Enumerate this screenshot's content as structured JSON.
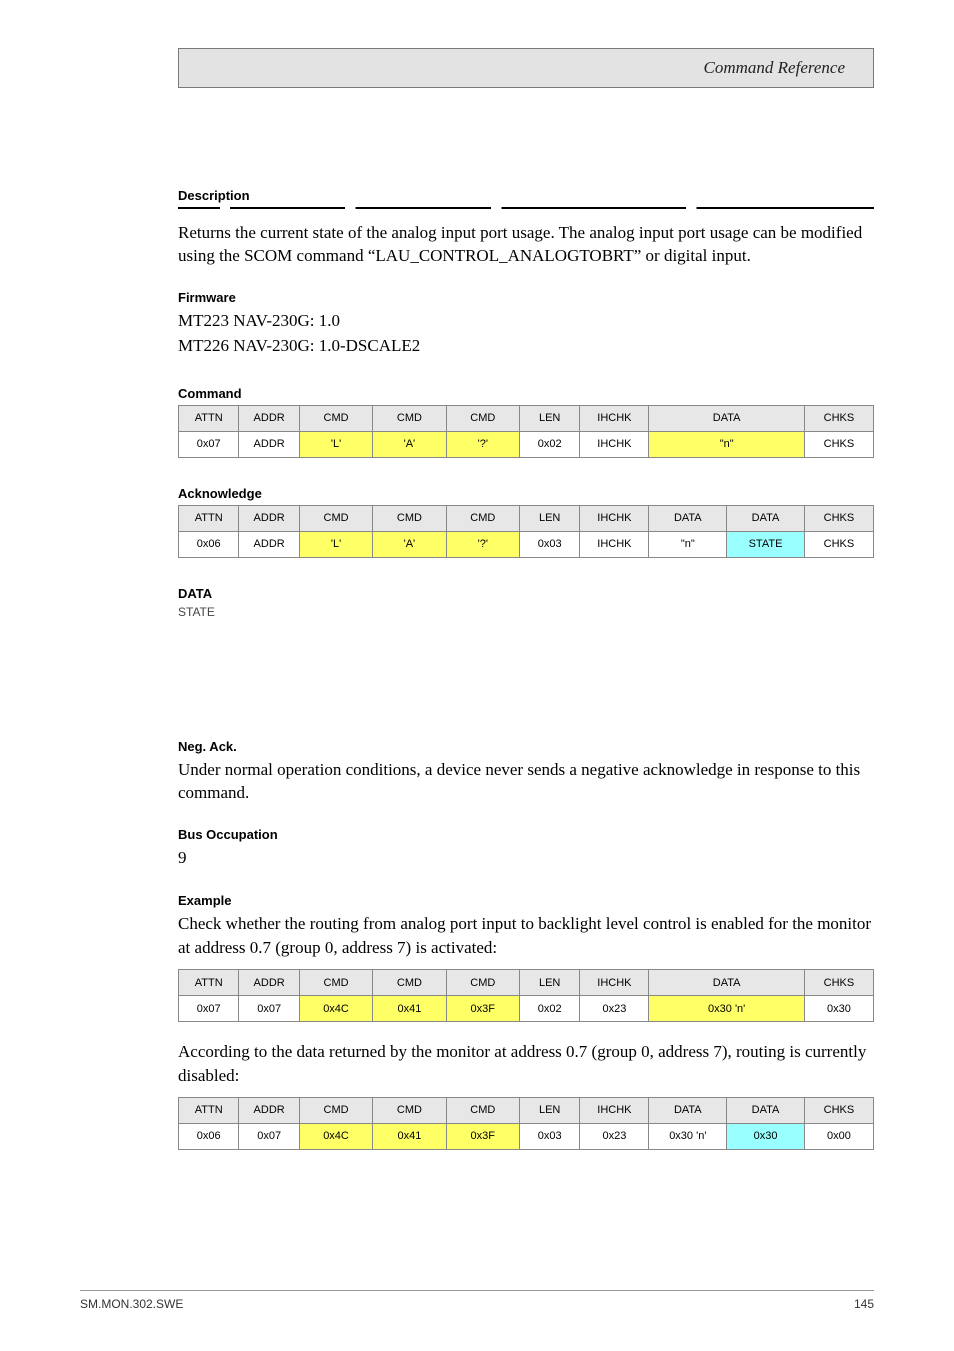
{
  "header": {
    "title": "Command Reference"
  },
  "description": {
    "label": "Description",
    "text": "Returns the current state of the analog input port usage. The analog input port usage can be modified using the SCOM command “LAU_CONTROL_ANALOGTOBRT” or digital input."
  },
  "firmware": {
    "label": "Firmware",
    "line1": "MT223 NAV-230G: 1.0",
    "line2": "MT226 NAV-230G: 1.0-DSCALE2"
  },
  "command_table": {
    "label": "Command",
    "headers": [
      "ATTN",
      "ADDR",
      "CMD",
      "CMD",
      "CMD",
      "LEN",
      "IHCHK",
      "DATA",
      "CHKS"
    ],
    "row": [
      "0x07",
      "ADDR",
      "'L'",
      "'A'",
      "'?'",
      "0x02",
      "IHCHK",
      "\"n\"",
      "CHKS"
    ],
    "row_classes": [
      "",
      "",
      "y",
      "y",
      "y",
      "",
      "",
      "y y",
      "",
      ""
    ]
  },
  "ack_table": {
    "label": "Acknowledge",
    "headers": [
      "ATTN",
      "ADDR",
      "CMD",
      "CMD",
      "CMD",
      "LEN",
      "IHCHK",
      "DATA",
      "DATA",
      "CHKS"
    ],
    "row": [
      "0x06",
      "ADDR",
      "'L'",
      "'A'",
      "'?'",
      "0x03",
      "IHCHK",
      "\"n\"",
      "STATE",
      "CHKS"
    ]
  },
  "data_section": {
    "label": "DATA",
    "state_text": "STATE"
  },
  "nack": {
    "label": "Neg. Ack.",
    "text": "Under normal operation conditions, a device never sends a negative acknowledge in response to this command."
  },
  "busoccupation": {
    "label": "Bus Occupation",
    "value": "9"
  },
  "example": {
    "label": "Example",
    "intro": "Check whether the routing from analog port input to backlight level control is enabled for the monitor at address 0.7 (group 0, address 7) is activated:",
    "req_headers": [
      "ATTN",
      "ADDR",
      "CMD",
      "CMD",
      "CMD",
      "LEN",
      "IHCHK",
      "DATA",
      "CHKS"
    ],
    "req_row": [
      "0x07",
      "0x07",
      "0x4C",
      "0x41",
      "0x3F",
      "0x02",
      "0x23",
      "0x30 'n'",
      "0x30"
    ],
    "resp_intro": "According to the data returned by the monitor at address 0.7 (group 0, address 7), routing is currently disabled:",
    "resp_headers": [
      "ATTN",
      "ADDR",
      "CMD",
      "CMD",
      "CMD",
      "LEN",
      "IHCHK",
      "DATA",
      "DATA",
      "CHKS"
    ],
    "resp_row": [
      "0x06",
      "0x07",
      "0x4C",
      "0x41",
      "0x3F",
      "0x03",
      "0x23",
      "0x30 'n'",
      "0x30",
      "0x00"
    ]
  },
  "footer": {
    "left": "SM.MON.302.SWE",
    "right": "145"
  }
}
